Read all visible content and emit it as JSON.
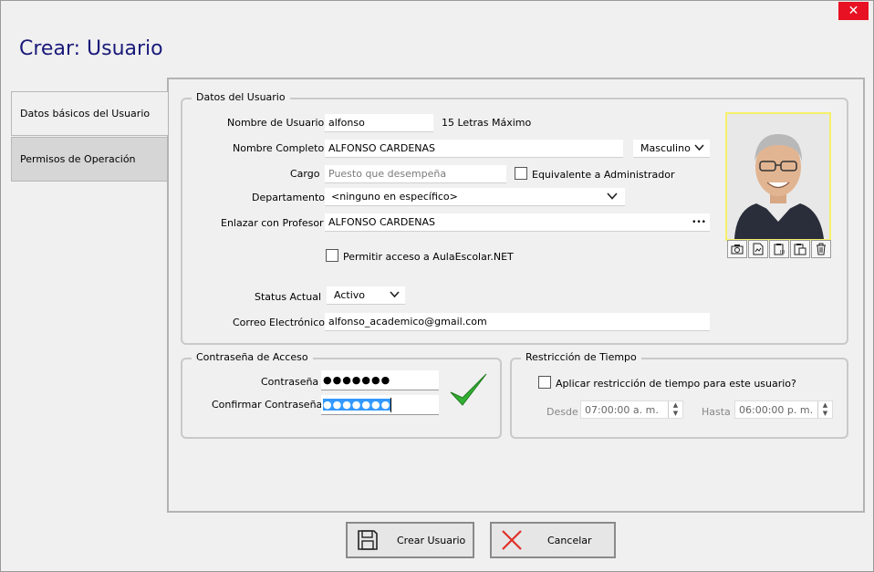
{
  "window": {
    "title": "Crear: Usuario",
    "close_glyph": "✕"
  },
  "tabs": [
    {
      "label": "Datos básicos del Usuario"
    },
    {
      "label": "Permisos de Operación"
    }
  ],
  "datos_usuario": {
    "legend": "Datos del Usuario",
    "nombre_usuario": {
      "label": "Nombre de Usuario",
      "value": "alfonso",
      "hint": "15 Letras Máximo"
    },
    "nombre_completo": {
      "label": "Nombre Completo",
      "value": "ALFONSO CARDENAS"
    },
    "genero": {
      "value": "Masculino"
    },
    "cargo": {
      "label": "Cargo",
      "placeholder": "Puesto que desempeña"
    },
    "equivalente_admin": {
      "label": "Equivalente a Administrador",
      "checked": false
    },
    "departamento": {
      "label": "Departamento",
      "value": "<ninguno en específico>"
    },
    "profesor": {
      "label": "Enlazar con Profesor",
      "value": "ALFONSO CARDENAS",
      "more_glyph": "•••"
    },
    "acceso_aula": {
      "label": "Permitir acceso a AulaEscolar.NET",
      "checked": false
    },
    "status": {
      "label": "Status Actual",
      "value": "Activo"
    },
    "correo": {
      "label": "Correo Electrónico",
      "value": "alfonso_academico@gmail.com"
    }
  },
  "photo_tools": [
    "camera-icon",
    "image-file-icon",
    "paste-special-icon",
    "paste-icon",
    "trash-icon"
  ],
  "contrasena": {
    "legend": "Contraseña de Acceso",
    "password": {
      "label": "Contraseña",
      "value": "●●●●●●●"
    },
    "confirm": {
      "label": "Confirmar Contraseña",
      "value": "●●●●●●●"
    },
    "valid_color": "#22a022"
  },
  "restriccion": {
    "legend": "Restricción de Tiempo",
    "aplicar": {
      "label": "Aplicar restricción de tiempo para este usuario?",
      "checked": false
    },
    "desde": {
      "label": "Desde",
      "value": "07:00:00 a. m."
    },
    "hasta": {
      "label": "Hasta",
      "value": "06:00:00 p. m."
    }
  },
  "buttons": {
    "crear": "Crear Usuario",
    "cancelar": "Cancelar"
  },
  "colors": {
    "title": "#1a1a7a",
    "cancel_x": "#e0302a",
    "selection": "#3399ff"
  }
}
